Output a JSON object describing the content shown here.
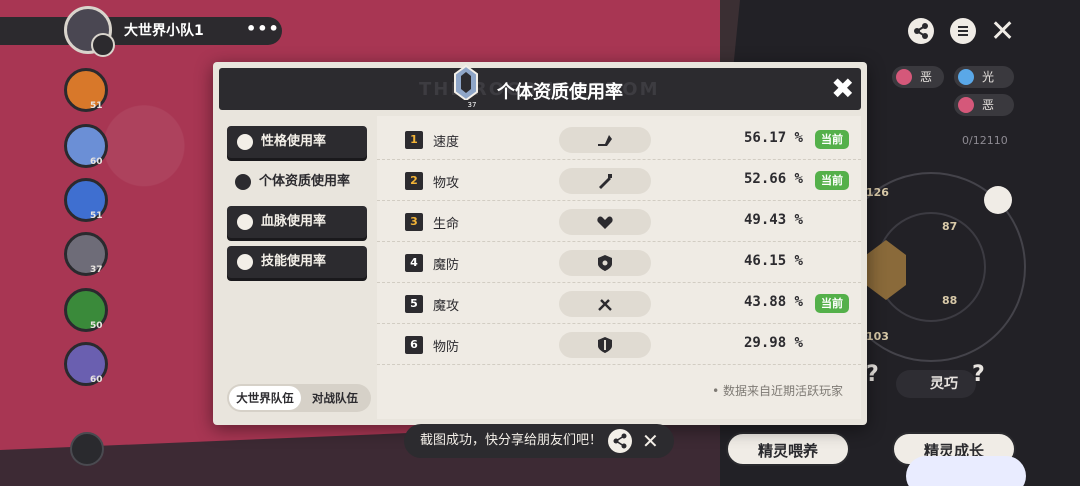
{
  "team": {
    "name": "大世界小队1",
    "more_label": "•••"
  },
  "pets": [
    {
      "level": "51",
      "color": "#d8782a"
    },
    {
      "level": "60",
      "color": "#6b8fd6"
    },
    {
      "level": "51",
      "color": "#3f6fd0"
    },
    {
      "level": "37",
      "color": "#6e6c78"
    },
    {
      "level": "50",
      "color": "#3a8a3a"
    },
    {
      "level": "60",
      "color": "#6a5fb0"
    }
  ],
  "side_panel": {
    "chips": {
      "evil1": "恶",
      "light": "光",
      "evil2": "恶"
    },
    "exp": "0/12110",
    "stats": {
      "s126": "126",
      "s87": "87",
      "s88": "88",
      "s103": "103"
    },
    "skill_chip": "灵巧",
    "feed_button": "精灵喂养",
    "grow_button": "精灵成长"
  },
  "modal": {
    "watermark": "THE ROCO KINGDOM",
    "title": "个体资质使用率",
    "badge_level": "37",
    "close": "✖",
    "tabs": [
      {
        "label": "性格使用率",
        "active": false
      },
      {
        "label": "个体资质使用率",
        "active": true
      },
      {
        "label": "血脉使用率",
        "active": false
      },
      {
        "label": "技能使用率",
        "active": false
      }
    ],
    "team_toggle": {
      "world": "大世界队伍",
      "battle": "对战队伍"
    },
    "rows": [
      {
        "rank": "1",
        "name": "速度",
        "icon": "speed-icon",
        "percent": "56.17 %",
        "current": "当前"
      },
      {
        "rank": "2",
        "name": "物攻",
        "icon": "physical-attack-icon",
        "percent": "52.66 %",
        "current": "当前"
      },
      {
        "rank": "3",
        "name": "生命",
        "icon": "health-icon",
        "percent": "49.43 %",
        "current": ""
      },
      {
        "rank": "4",
        "name": "魔防",
        "icon": "magic-defense-icon",
        "percent": "46.15 %",
        "current": ""
      },
      {
        "rank": "5",
        "name": "魔攻",
        "icon": "magic-attack-icon",
        "percent": "43.88 %",
        "current": "当前"
      },
      {
        "rank": "6",
        "name": "物防",
        "icon": "physical-defense-icon",
        "percent": "29.98 %",
        "current": ""
      }
    ],
    "source_note": "数据来自近期活跃玩家"
  },
  "toast": {
    "text": "截图成功，快分享给朋友们吧！"
  },
  "colors": {
    "accent_green": "#54b04a",
    "panel_dark": "#2c2b2f",
    "rank_gold": "#f3b437"
  }
}
